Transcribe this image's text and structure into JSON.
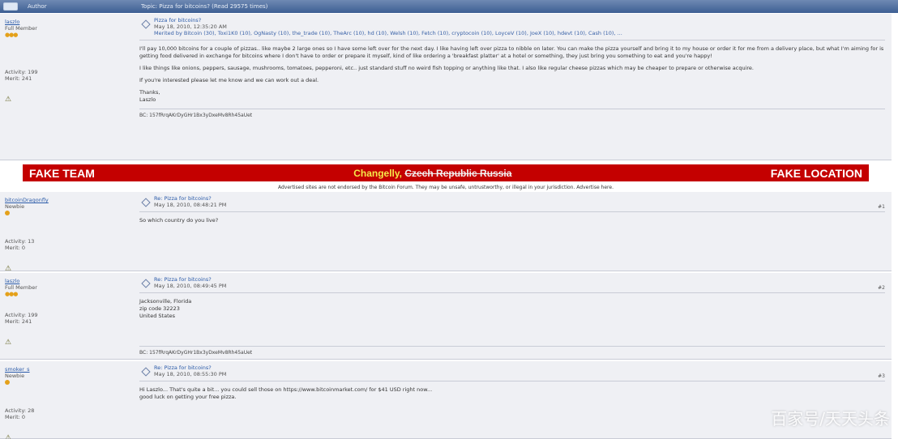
{
  "topbar": {
    "author_label": "Author",
    "topic_label": "Topic: Pizza for bitcoins? (Read 29575 times)"
  },
  "banner": {
    "left": "FAKE TEAM",
    "mid_highlight": "Changelly,",
    "mid_struck": "Czech Republic Russia",
    "right": "FAKE LOCATION"
  },
  "note": "Advertised sites are not endorsed by the Bitcoin Forum. They may be unsafe, untrustworthy, or illegal in your jurisdiction. Advertise here.",
  "posts": [
    {
      "user": "laszlo",
      "rank": "Full Member",
      "activity": "Activity: 199",
      "merit": "Merit: 241",
      "title": "Pizza for bitcoins?",
      "date": "May 18, 2010, 12:35:20 AM",
      "quote": "Merited by Bitcoin (30), Toxi1K0 (10), OgNasty (10), the_trade (10), TheArc (10), hd (10), Welsh (10), Fetch (10), cryptocoin (10), LoyceV (10), JoeX (10), hdevt (10), Cash (10), ...",
      "paras": [
        "I'll pay 10,000 bitcoins for a couple of pizzas.. like maybe 2 large ones so I have some left over for the next day. I like having left over pizza to nibble on later. You can make the pizza yourself and bring it to my house or order it for me from a delivery place, but what I'm aiming for is getting food delivered in exchange for bitcoins where I don't have to order or prepare it myself, kind of like ordering a 'breakfast platter' at a hotel or something, they just bring you something to eat and you're happy!",
        "I like things like onions, peppers, sausage, mushrooms, tomatoes, pepperoni, etc.. just standard stuff no weird fish topping or anything like that. I also like regular cheese pizzas which may be cheaper to prepare or otherwise acquire.",
        "If you're interested please let me know and we can work out a deal.",
        "Thanks,",
        "Laszlo"
      ],
      "signature": "BC: 157fRrqAKrDyGHr1Bx3yDxeMv8Rh45aUet"
    },
    {
      "user": "bitcoinDragonfly",
      "rank": "Newbie",
      "activity": "Activity: 13",
      "merit": "Merit: 0",
      "title": "Re: Pizza for bitcoins?",
      "date": "May 18, 2010, 08:48:21 PM",
      "num": "#1",
      "paras": [
        "So which country do you live?"
      ]
    },
    {
      "user": "laszlo",
      "rank": "Full Member",
      "activity": "Activity: 199",
      "merit": "Merit: 241",
      "title": "Re: Pizza for bitcoins?",
      "date": "May 18, 2010, 08:49:45 PM",
      "num": "#2",
      "lines": [
        "Jacksonville, Florida",
        "zip code 32223",
        "United States"
      ],
      "signature": "BC: 157fRrqAKrDyGHr1Bx3yDxeMv8Rh45aUet"
    },
    {
      "user": "smoker_s",
      "rank": "Newbie",
      "activity": "Activity: 28",
      "merit": "Merit: 0",
      "title": "Re: Pizza for bitcoins?",
      "date": "May 18, 2010, 08:55:30 PM",
      "num": "#3",
      "lines": [
        "Hi Laszlo... That's quite a bit... you could sell those on https://www.bitcoinmarket.com/ for $41 USD right now...",
        "good luck on getting your free pizza."
      ]
    }
  ],
  "watermark": "百家号/天天头条"
}
